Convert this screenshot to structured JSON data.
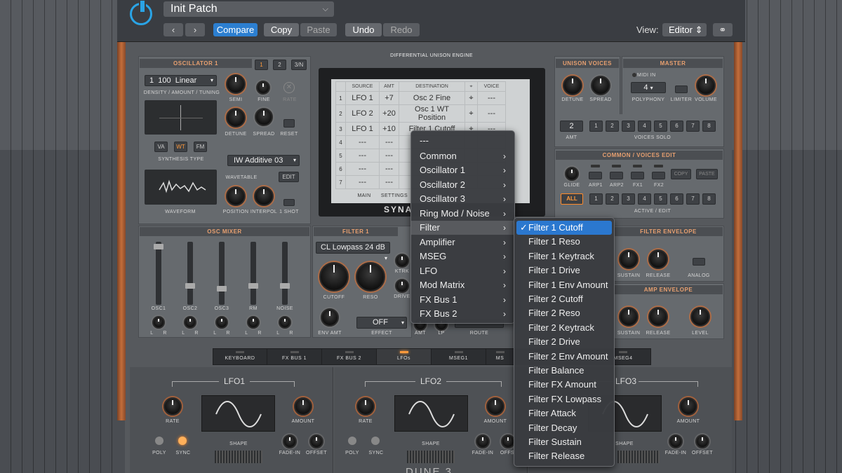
{
  "host": {
    "patch": "Init Patch",
    "compare": "Compare",
    "copy": "Copy",
    "paste": "Paste",
    "undo": "Undo",
    "redo": "Redo",
    "view_label": "View:",
    "view_value": "Editor"
  },
  "osc1": {
    "title": "OSCILLATOR 1",
    "mode_buttons": [
      "1",
      "2",
      "3/N"
    ],
    "density": "1",
    "amount": "100",
    "tuning": "Linear",
    "dat_label": "DENSITY / AMOUNT / TUNING",
    "semi": "SEMI",
    "fine": "FINE",
    "rate": "RATE",
    "detune": "DETUNE",
    "spread": "SPREAD",
    "reset": "RESET",
    "synth_types": [
      "VA",
      "WT",
      "FM"
    ],
    "synth_type_label": "SYNTHESIS TYPE",
    "wavetable_value": "IW Additive 03",
    "wavetable_label": "WAVETABLE",
    "edit": "EDIT",
    "waveform": "WAVEFORM",
    "position": "POSITION",
    "interpol": "INTERPOL",
    "oneshot": "1 SHOT"
  },
  "engine_title": "DIFFERENTIAL UNISON ENGINE",
  "matrix": {
    "headers": [
      "SOURCE",
      "AMT",
      "DESTINATION",
      "VOICE"
    ],
    "rows": [
      {
        "n": "1",
        "src": "LFO 1",
        "amt": "+7",
        "dest": "Osc 2 Fine",
        "voice": "---"
      },
      {
        "n": "2",
        "src": "LFO 2",
        "amt": "+20",
        "dest": "Osc 1 WT Position",
        "voice": "---"
      },
      {
        "n": "3",
        "src": "LFO 1",
        "amt": "+10",
        "dest": "Filter 1 Cutoff",
        "voice": "---"
      },
      {
        "n": "4",
        "src": "---",
        "amt": "---",
        "dest": "",
        "voice": ""
      },
      {
        "n": "5",
        "src": "---",
        "amt": "---",
        "dest": "",
        "voice": ""
      },
      {
        "n": "6",
        "src": "---",
        "amt": "---",
        "dest": "",
        "voice": ""
      },
      {
        "n": "7",
        "src": "---",
        "amt": "---",
        "dest": "",
        "voice": ""
      }
    ],
    "tab_main": "MAIN",
    "tab_settings": "SETTINGS",
    "brand": "SYNA"
  },
  "unison": {
    "title": "UNISON VOICES",
    "detune": "DETUNE",
    "spread": "SPREAD",
    "amt_value": "2",
    "amt_label": "AMT",
    "voices": [
      "1",
      "2",
      "3",
      "4",
      "5",
      "6",
      "7",
      "8"
    ],
    "voices_solo": "VOICES SOLO"
  },
  "master": {
    "title": "MASTER",
    "midi_in": "MIDI IN",
    "polyphony_value": "4",
    "polyphony": "POLYPHONY",
    "limiter": "LIMITER",
    "volume": "VOLUME"
  },
  "common": {
    "title": "COMMON / VOICES EDIT",
    "glide": "GLIDE",
    "arp1": "ARP1",
    "arp2": "ARP2",
    "fx1": "FX1",
    "fx2": "FX2",
    "copy": "COPY",
    "paste": "PASTE",
    "all": "ALL",
    "active_edit": "ACTIVE / EDIT"
  },
  "oscmix": {
    "title": "OSC MIXER",
    "channels": [
      "OSC1",
      "OSC2",
      "OSC3",
      "RM",
      "NOISE"
    ],
    "l": "L",
    "r": "R"
  },
  "filter1": {
    "title": "FILTER 1",
    "type": "CL Lowpass 24 dB",
    "cutoff": "CUTOFF",
    "reso": "RESO",
    "ktrk": "KTRK",
    "drive": "DRIVE",
    "env_amt": "ENV AMT",
    "effect_value": "OFF",
    "effect": "EFFECT",
    "amt": "AMT",
    "lp": "LP",
    "route": "ROUTE"
  },
  "filter_env": {
    "title": "FILTER ENVELOPE",
    "sustain": "SUSTAIN",
    "release": "RELEASE",
    "analog": "ANALOG"
  },
  "amp_env": {
    "title": "AMP ENVELOPE",
    "sustain": "SUSTAIN",
    "release": "RELEASE",
    "level": "LEVEL"
  },
  "tabs": [
    "KEYBOARD",
    "FX BUS 1",
    "FX BUS 2",
    "LFOs",
    "MSEG1",
    "MS",
    "MSEG4"
  ],
  "lfos": [
    {
      "title": "LFO1",
      "rate": "RATE",
      "amount": "AMOUNT",
      "poly": "POLY",
      "sync": "SYNC",
      "shape": "SHAPE",
      "fadein": "FADE-IN",
      "offset": "OFFSET"
    },
    {
      "title": "LFO2",
      "rate": "RATE",
      "amount": "AMOUNT",
      "poly": "POLY",
      "sync": "SYNC",
      "shape": "SHAPE",
      "fadein": "FADE-IN",
      "offset": "OFFS"
    },
    {
      "title": "LFO3",
      "amount": "AMOUNT",
      "shape": "SHAPE",
      "fadein": "FADE-IN",
      "offset": "OFFSET"
    }
  ],
  "footer_brand": "DUNE 3",
  "menu": {
    "items": [
      "---",
      "Common",
      "Oscillator 1",
      "Oscillator 2",
      "Oscillator 3",
      "Ring Mod / Noise",
      "Filter",
      "Amplifier",
      "MSEG",
      "LFO",
      "Mod Matrix",
      "FX Bus 1",
      "FX Bus 2"
    ],
    "check": "✓"
  },
  "submenu": {
    "items": [
      "Filter 1 Cutoff",
      "Filter 1 Reso",
      "Filter 1 Keytrack",
      "Filter 1 Drive",
      "Filter 1 Env Amount",
      "Filter 2 Cutoff",
      "Filter 2 Reso",
      "Filter 2 Keytrack",
      "Filter 2 Drive",
      "Filter 2 Env Amount",
      "Filter Balance",
      "Filter FX Amount",
      "Filter FX Lowpass",
      "Filter Attack",
      "Filter Decay",
      "Filter Sustain",
      "Filter Release"
    ],
    "selected": 0
  }
}
